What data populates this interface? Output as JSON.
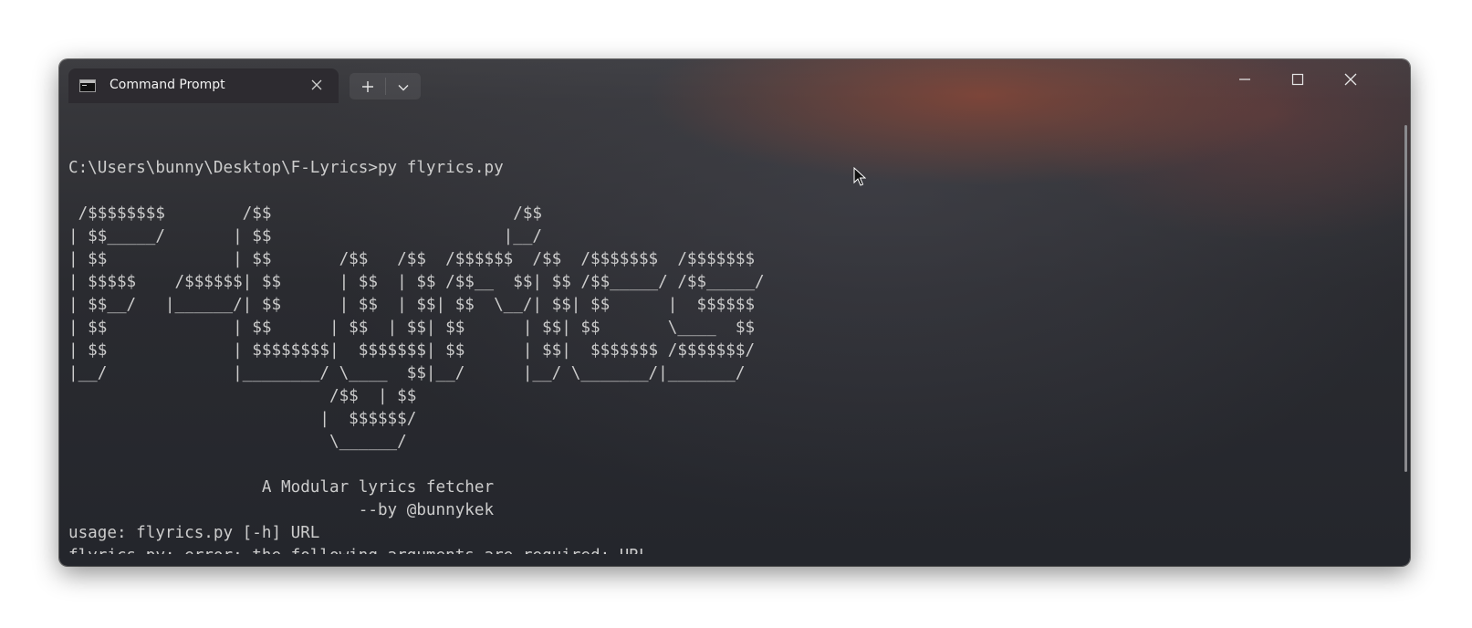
{
  "window": {
    "tab_title": "Command Prompt",
    "tab_icon": "cmd-icon",
    "controls": [
      "minimize-icon",
      "maximize-icon",
      "close-icon"
    ]
  },
  "console": {
    "lines": [
      "",
      "C:\\Users\\bunny\\Desktop\\F-Lyrics>py flyrics.py",
      "",
      " /$$$$$$$$        /$$                         /$$",
      "| $$_____/       | $$                        |__/",
      "| $$             | $$       /$$   /$$  /$$$$$$  /$$  /$$$$$$$  /$$$$$$$",
      "| $$$$$    /$$$$$$| $$      | $$  | $$ /$$__  $$| $$ /$$_____/ /$$_____/",
      "| $$__/   |______/| $$      | $$  | $$| $$  \\__/| $$| $$      |  $$$$$$",
      "| $$             | $$      | $$  | $$| $$      | $$| $$       \\____  $$",
      "| $$             | $$$$$$$$|  $$$$$$$| $$      | $$|  $$$$$$$ /$$$$$$$/",
      "|__/             |________/ \\____  $$|__/      |__/ \\_______/|_______/",
      "                           /$$  | $$",
      "                          |  $$$$$$/",
      "                           \\______/",
      "",
      "                    A Modular lyrics fetcher",
      "                              --by @bunnykek",
      "usage: flyrics.py [-h] URL",
      "flyrics.py: error: the following arguments are required: URL"
    ]
  },
  "colors": {
    "text": "#cccccc",
    "tab_background": "#2d2b30",
    "window_background": "#2a2b30"
  }
}
